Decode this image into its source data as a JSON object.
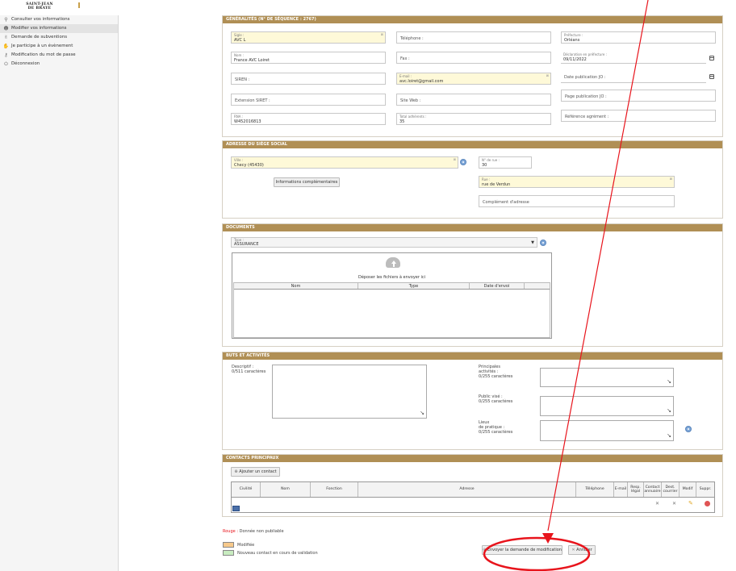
{
  "logo": {
    "line1": "SAINT-JEAN",
    "line2": "DE BRAYE"
  },
  "sidebar": {
    "items": [
      {
        "label": "Consulter vos informations",
        "icon": "search-icon"
      },
      {
        "label": "Modifier vos informations",
        "icon": "users-icon"
      },
      {
        "label": "Demande de subventions",
        "icon": "hand-icon"
      },
      {
        "label": "Je participe à un évènement",
        "icon": "handshake-icon"
      },
      {
        "label": "Modification du mot de passe",
        "icon": "key-icon"
      },
      {
        "label": "Déconnexion",
        "icon": "power-icon"
      }
    ]
  },
  "general": {
    "title": "GÉNÉRALITÉS (N° DE SÉQUENCE : 2767)",
    "sigle_label": "Sigle :",
    "sigle_value": "AVC L",
    "nom_label": "Nom :",
    "nom_value": "France AVC Loiret",
    "siren_label": "SIREN :",
    "extension_label": "Extension SIRET :",
    "rna_label": "RNA :",
    "rna_value": "W452016813",
    "telephone_label": "Téléphone :",
    "fax_label": "Fax :",
    "email_label": "E-mail :",
    "email_value": "avc.loiret@gmail.com",
    "site_label": "Site Web :",
    "adherents_label": "Total adhérents :",
    "adherents_value": "35",
    "prefecture_label": "Préfecture :",
    "prefecture_value": "Orléans",
    "declaration_label": "Déclaration en préfecture :",
    "declaration_value": "09/11/2022",
    "date_pub_label": "Date publication JO :",
    "page_pub_label": "Page publication JO :",
    "agrement_label": "Référence agrément :"
  },
  "address": {
    "title": "ADRESSE DU SIÈGE SOCIAL",
    "ville_label": "Ville :",
    "ville_value": "Checy (45430)",
    "num_label": "N° de rue :",
    "num_value": "30",
    "rue_label": "Rue :",
    "rue_value": "rue de Verdun",
    "complement_label": "Complément d'adresse",
    "info_button": "Informations complémentaires"
  },
  "documents": {
    "title": "DOCUMENTS",
    "type_label": "Type :",
    "type_value": "ASSURANCE",
    "drop_text": "Déposer les fichiers à envoyer ici",
    "columns": [
      "Nom",
      "Type",
      "Date d'envoi"
    ]
  },
  "buts": {
    "title": "BUTS ET ACTIVITÉS",
    "descriptif_label": "Descriptif :",
    "descriptif_count": "0/511 caractères",
    "principales_label1": "Principales",
    "principales_label2": "activités :",
    "principales_count": "0/255 caractères",
    "public_label": "Public visé :",
    "public_count": "0/255 caractères",
    "lieux_label1": "Lieux",
    "lieux_label2": "de pratique :",
    "lieux_count": "0/255 caractères"
  },
  "contacts": {
    "title": "CONTACTS PRINCIPAUX",
    "add_button": "Ajouter un contact",
    "columns": [
      "Civilité",
      "Nom",
      "Fonction",
      "Adresse",
      "Téléphone",
      "E-mail",
      "Resp. légal",
      "Contact annuaire",
      "Dest. courrier",
      "Modif",
      "Suppr."
    ]
  },
  "legend": {
    "rouge_label": "Rouge :",
    "rouge_text": "Donnée non publiable",
    "modified": "Modifiée",
    "new_contact": "Nouveau contact en cours de validation"
  },
  "actions": {
    "send_button": "Envoyer la demande de modification",
    "cancel_button": "Annuler"
  },
  "colors": {
    "header": "#b08f55",
    "required_bg": "#fef9d8",
    "annotation_red": "#e8141c",
    "modified_swatch": "#f7c98b",
    "new_swatch": "#c8ecc0"
  }
}
